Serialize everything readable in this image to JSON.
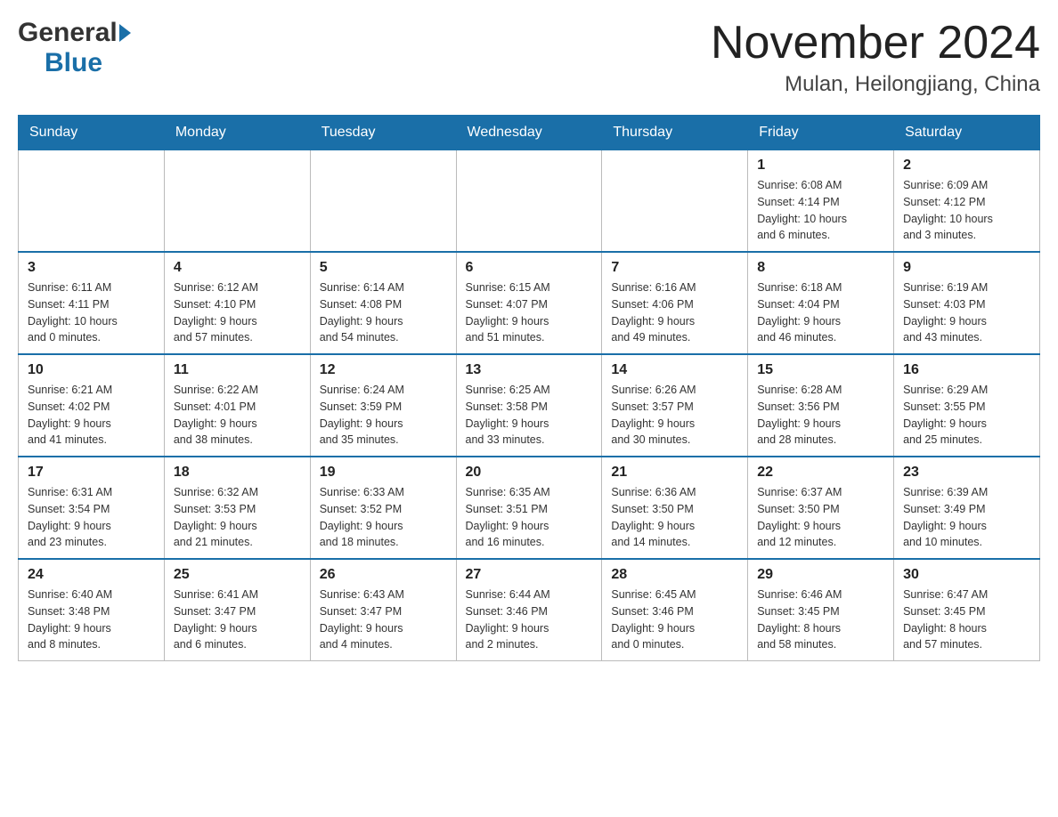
{
  "header": {
    "logo_general": "General",
    "logo_blue": "Blue",
    "title": "November 2024",
    "subtitle": "Mulan, Heilongjiang, China"
  },
  "days_of_week": [
    "Sunday",
    "Monday",
    "Tuesday",
    "Wednesday",
    "Thursday",
    "Friday",
    "Saturday"
  ],
  "weeks": [
    {
      "days": [
        {
          "number": "",
          "info": ""
        },
        {
          "number": "",
          "info": ""
        },
        {
          "number": "",
          "info": ""
        },
        {
          "number": "",
          "info": ""
        },
        {
          "number": "",
          "info": ""
        },
        {
          "number": "1",
          "info": "Sunrise: 6:08 AM\nSunset: 4:14 PM\nDaylight: 10 hours\nand 6 minutes."
        },
        {
          "number": "2",
          "info": "Sunrise: 6:09 AM\nSunset: 4:12 PM\nDaylight: 10 hours\nand 3 minutes."
        }
      ]
    },
    {
      "days": [
        {
          "number": "3",
          "info": "Sunrise: 6:11 AM\nSunset: 4:11 PM\nDaylight: 10 hours\nand 0 minutes."
        },
        {
          "number": "4",
          "info": "Sunrise: 6:12 AM\nSunset: 4:10 PM\nDaylight: 9 hours\nand 57 minutes."
        },
        {
          "number": "5",
          "info": "Sunrise: 6:14 AM\nSunset: 4:08 PM\nDaylight: 9 hours\nand 54 minutes."
        },
        {
          "number": "6",
          "info": "Sunrise: 6:15 AM\nSunset: 4:07 PM\nDaylight: 9 hours\nand 51 minutes."
        },
        {
          "number": "7",
          "info": "Sunrise: 6:16 AM\nSunset: 4:06 PM\nDaylight: 9 hours\nand 49 minutes."
        },
        {
          "number": "8",
          "info": "Sunrise: 6:18 AM\nSunset: 4:04 PM\nDaylight: 9 hours\nand 46 minutes."
        },
        {
          "number": "9",
          "info": "Sunrise: 6:19 AM\nSunset: 4:03 PM\nDaylight: 9 hours\nand 43 minutes."
        }
      ]
    },
    {
      "days": [
        {
          "number": "10",
          "info": "Sunrise: 6:21 AM\nSunset: 4:02 PM\nDaylight: 9 hours\nand 41 minutes."
        },
        {
          "number": "11",
          "info": "Sunrise: 6:22 AM\nSunset: 4:01 PM\nDaylight: 9 hours\nand 38 minutes."
        },
        {
          "number": "12",
          "info": "Sunrise: 6:24 AM\nSunset: 3:59 PM\nDaylight: 9 hours\nand 35 minutes."
        },
        {
          "number": "13",
          "info": "Sunrise: 6:25 AM\nSunset: 3:58 PM\nDaylight: 9 hours\nand 33 minutes."
        },
        {
          "number": "14",
          "info": "Sunrise: 6:26 AM\nSunset: 3:57 PM\nDaylight: 9 hours\nand 30 minutes."
        },
        {
          "number": "15",
          "info": "Sunrise: 6:28 AM\nSunset: 3:56 PM\nDaylight: 9 hours\nand 28 minutes."
        },
        {
          "number": "16",
          "info": "Sunrise: 6:29 AM\nSunset: 3:55 PM\nDaylight: 9 hours\nand 25 minutes."
        }
      ]
    },
    {
      "days": [
        {
          "number": "17",
          "info": "Sunrise: 6:31 AM\nSunset: 3:54 PM\nDaylight: 9 hours\nand 23 minutes."
        },
        {
          "number": "18",
          "info": "Sunrise: 6:32 AM\nSunset: 3:53 PM\nDaylight: 9 hours\nand 21 minutes."
        },
        {
          "number": "19",
          "info": "Sunrise: 6:33 AM\nSunset: 3:52 PM\nDaylight: 9 hours\nand 18 minutes."
        },
        {
          "number": "20",
          "info": "Sunrise: 6:35 AM\nSunset: 3:51 PM\nDaylight: 9 hours\nand 16 minutes."
        },
        {
          "number": "21",
          "info": "Sunrise: 6:36 AM\nSunset: 3:50 PM\nDaylight: 9 hours\nand 14 minutes."
        },
        {
          "number": "22",
          "info": "Sunrise: 6:37 AM\nSunset: 3:50 PM\nDaylight: 9 hours\nand 12 minutes."
        },
        {
          "number": "23",
          "info": "Sunrise: 6:39 AM\nSunset: 3:49 PM\nDaylight: 9 hours\nand 10 minutes."
        }
      ]
    },
    {
      "days": [
        {
          "number": "24",
          "info": "Sunrise: 6:40 AM\nSunset: 3:48 PM\nDaylight: 9 hours\nand 8 minutes."
        },
        {
          "number": "25",
          "info": "Sunrise: 6:41 AM\nSunset: 3:47 PM\nDaylight: 9 hours\nand 6 minutes."
        },
        {
          "number": "26",
          "info": "Sunrise: 6:43 AM\nSunset: 3:47 PM\nDaylight: 9 hours\nand 4 minutes."
        },
        {
          "number": "27",
          "info": "Sunrise: 6:44 AM\nSunset: 3:46 PM\nDaylight: 9 hours\nand 2 minutes."
        },
        {
          "number": "28",
          "info": "Sunrise: 6:45 AM\nSunset: 3:46 PM\nDaylight: 9 hours\nand 0 minutes."
        },
        {
          "number": "29",
          "info": "Sunrise: 6:46 AM\nSunset: 3:45 PM\nDaylight: 8 hours\nand 58 minutes."
        },
        {
          "number": "30",
          "info": "Sunrise: 6:47 AM\nSunset: 3:45 PM\nDaylight: 8 hours\nand 57 minutes."
        }
      ]
    }
  ]
}
